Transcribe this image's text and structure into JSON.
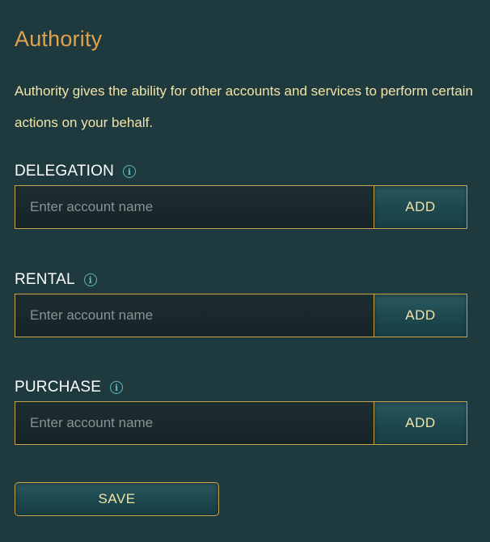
{
  "title": "Authority",
  "description": "Authority gives the ability for other accounts and services to perform certain actions on your behalf.",
  "info_icon_glyph": "i",
  "sections": [
    {
      "label": "DELEGATION",
      "icon": "info-icon",
      "input_placeholder": "Enter account name",
      "input_value": "",
      "button_label": "ADD"
    },
    {
      "label": "RENTAL",
      "icon": "info-icon",
      "input_placeholder": "Enter account name",
      "input_value": "",
      "button_label": "ADD"
    },
    {
      "label": "PURCHASE",
      "icon": "info-icon",
      "input_placeholder": "Enter account name",
      "input_value": "",
      "button_label": "ADD"
    }
  ],
  "save_label": "SAVE",
  "colors": {
    "background": "#1f3a3e",
    "title": "#e0a24b",
    "text": "#f2e3a8",
    "border": "#c9a24a",
    "info_icon": "#5fb8bd"
  }
}
